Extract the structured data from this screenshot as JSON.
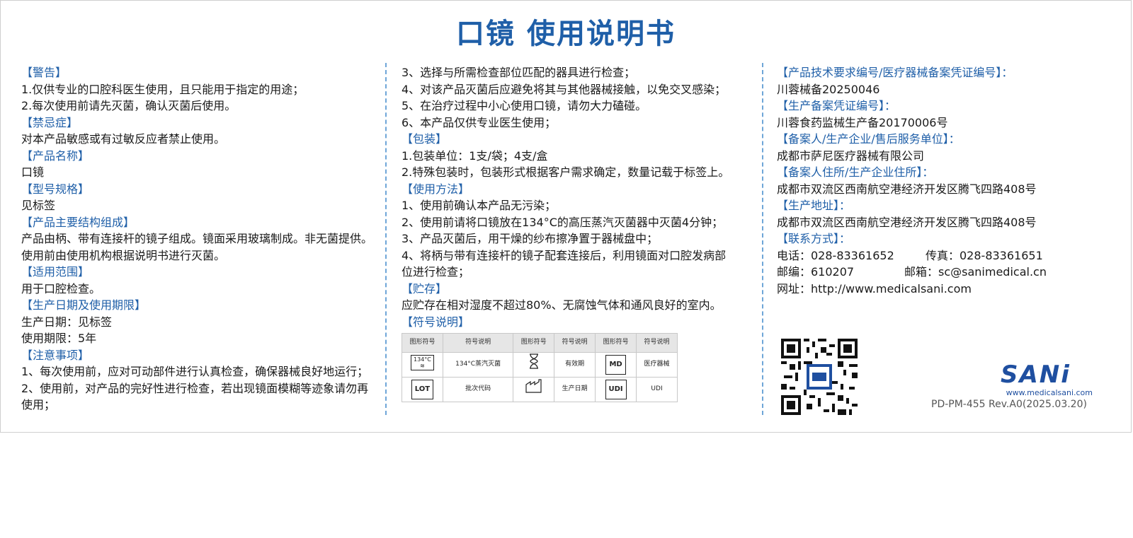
{
  "title": "口镜 使用说明书",
  "col1": {
    "warning_h": "【警告】",
    "warning_1": "1.仅供专业的口腔科医生使用，且只能用于指定的用途；",
    "warning_2": "2.每次使用前请先灭菌，确认灭菌后使用。",
    "contra_h": "【禁忌症】",
    "contra_1": "对本产品敏感或有过敏反应者禁止使用。",
    "name_h": "【产品名称】",
    "name_1": "口镜",
    "model_h": "【型号规格】",
    "model_1": "见标签",
    "struct_h": "【产品主要结构组成】",
    "struct_1": "产品由柄、带有连接杆的镜子组成。镜面采用玻璃制成。非无菌提供。",
    "struct_2": "使用前由使用机构根据说明书进行灭菌。",
    "scope_h": "【适用范围】",
    "scope_1": "用于口腔检查。",
    "date_h": "【生产日期及使用期限】",
    "date_1": "生产日期：见标签",
    "date_2": "使用期限：5年",
    "notes_h": "【注意事项】",
    "notes_1": "1、每次使用前，应对可动部件进行认真检查，确保器械良好地运行；",
    "notes_2": "2、使用前，对产品的完好性进行检查，若出现镜面模糊等迹象请勿再",
    "notes_3": "使用；"
  },
  "col2": {
    "notes_4": "3、选择与所需检查部位匹配的器具进行检查；",
    "notes_5": "4、对该产品灭菌后应避免将其与其他器械接触，以免交叉感染；",
    "notes_6": "5、在治疗过程中小心使用口镜，请勿大力磕碰。",
    "notes_7": "6、本产品仅供专业医生使用；",
    "pack_h": "【包装】",
    "pack_1": "1.包装单位：1支/袋；4支/盒",
    "pack_2": "2.特殊包装时，包装形式根据客户需求确定，数量记载于标签上。",
    "use_h": "【使用方法】",
    "use_1": "1、使用前确认本产品无污染；",
    "use_2": "2、使用前请将口镜放在134°C的高压蒸汽灭菌器中灭菌4分钟；",
    "use_3": "3、产品灭菌后，用干燥的纱布擦净置于器械盘中；",
    "use_4": "4、将柄与带有连接杆的镜子配套连接后，利用镜面对口腔发病部",
    "use_5": "位进行检查；",
    "store_h": "【贮存】",
    "store_1": "应贮存在相对湿度不超过80%、无腐蚀气体和通风良好的室内。",
    "sym_h": "【符号说明】",
    "sym_table": {
      "col_graphic": "图形符号",
      "col_desc": "符号说明",
      "r1": {
        "sym1_temp": "134°C",
        "desc1": "134°C蒸汽灭菌",
        "desc2": "有效期",
        "sym3": "MD",
        "desc3": "医疗器械"
      },
      "r2": {
        "sym1": "LOT",
        "desc1": "批次代码",
        "desc2": "生产日期",
        "sym3": "UDI",
        "desc3": "UDI"
      }
    }
  },
  "col3": {
    "reg_h": "【产品技术要求编号/医疗器械备案凭证编号】：",
    "reg_1": "川蓉械备20250046",
    "prod_h": "【生产备案凭证编号】：",
    "prod_1": "川蓉食药监械生产备20170006号",
    "comp_h": "【备案人/生产企业/售后服务单位】：",
    "comp_1": "成都市萨尼医疗器械有限公司",
    "addr_h": "【备案人住所/生产企业住所】：",
    "addr_1": "成都市双流区西南航空港经济开发区腾飞四路408号",
    "paddr_h": "【生产地址】：",
    "paddr_1": "成都市双流区西南航空港经济开发区腾飞四路408号",
    "contact_h": "【联系方式】：",
    "tel": "电话：028-83361652",
    "fax": "传真：028-83361651",
    "zip": "邮编：610207",
    "email": "邮箱：sc@sanimedical.cn",
    "web": "网址：http://www.medicalsani.com"
  },
  "logo": {
    "text": "SANi",
    "url": "www.medicalsani.com"
  },
  "doc_number": "PD-PM-455   Rev.A0(2025.03.20)",
  "colors": {
    "accent": "#1f5fa8",
    "divider": "#6fa6d8"
  }
}
